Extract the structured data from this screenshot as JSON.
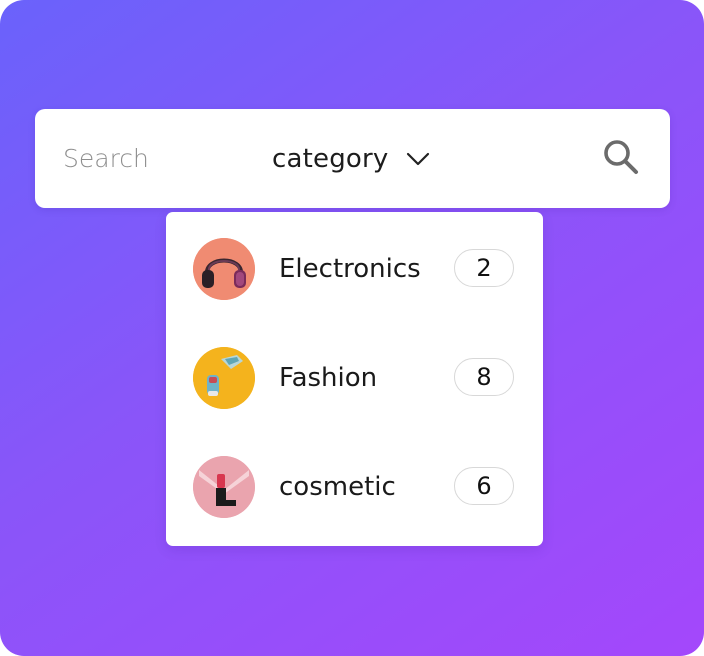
{
  "search": {
    "placeholder": "Search",
    "category_label": "category",
    "chevron_icon": "chevron-down-icon",
    "search_icon": "search-icon"
  },
  "dropdown": {
    "items": [
      {
        "label": "Electronics",
        "count": "2",
        "thumbnail": "headphones-image"
      },
      {
        "label": "Fashion",
        "count": "8",
        "thumbnail": "sneaker-image"
      },
      {
        "label": "cosmetic",
        "count": "6",
        "thumbnail": "lipstick-image"
      }
    ]
  },
  "colors": {
    "background_gradient_start": "#6a62fb",
    "background_gradient_end": "#a447fb",
    "panel": "#ffffff",
    "text": "#1a1a1a",
    "placeholder": "#8e8e8e",
    "icon": "#6b6b6b"
  }
}
